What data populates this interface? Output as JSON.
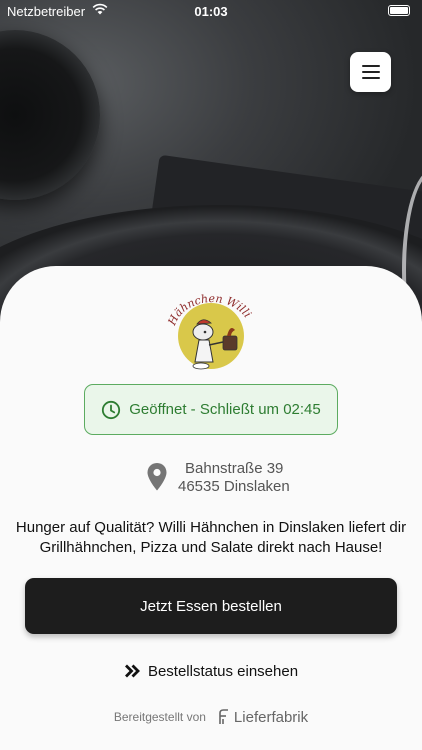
{
  "status_bar": {
    "carrier": "Netzbetreiber",
    "time": "01:03"
  },
  "header": {
    "menu_icon": "hamburger-menu-icon"
  },
  "logo": {
    "text": "Hähnchen Willi"
  },
  "open_status": {
    "label": "Geöffnet - Schließt um 02:45",
    "color": "#2e7d32",
    "icon": "clock-icon"
  },
  "address": {
    "street": "Bahnstraße 39",
    "city": "46535 Dinslaken",
    "icon": "location-pin-icon"
  },
  "tagline": "Hunger auf Qualität? Willi Hähnchen in Dinslaken liefert dir Grillhähnchen, Pizza und Salate direkt nach Hause!",
  "order_button": {
    "label": "Jetzt Essen bestellen"
  },
  "order_status_link": {
    "label": "Bestellstatus einsehen",
    "icon": "double-chevron-right-icon"
  },
  "footer": {
    "provided_by": "Bereitgestellt von",
    "brand": "Lieferfabrik"
  }
}
